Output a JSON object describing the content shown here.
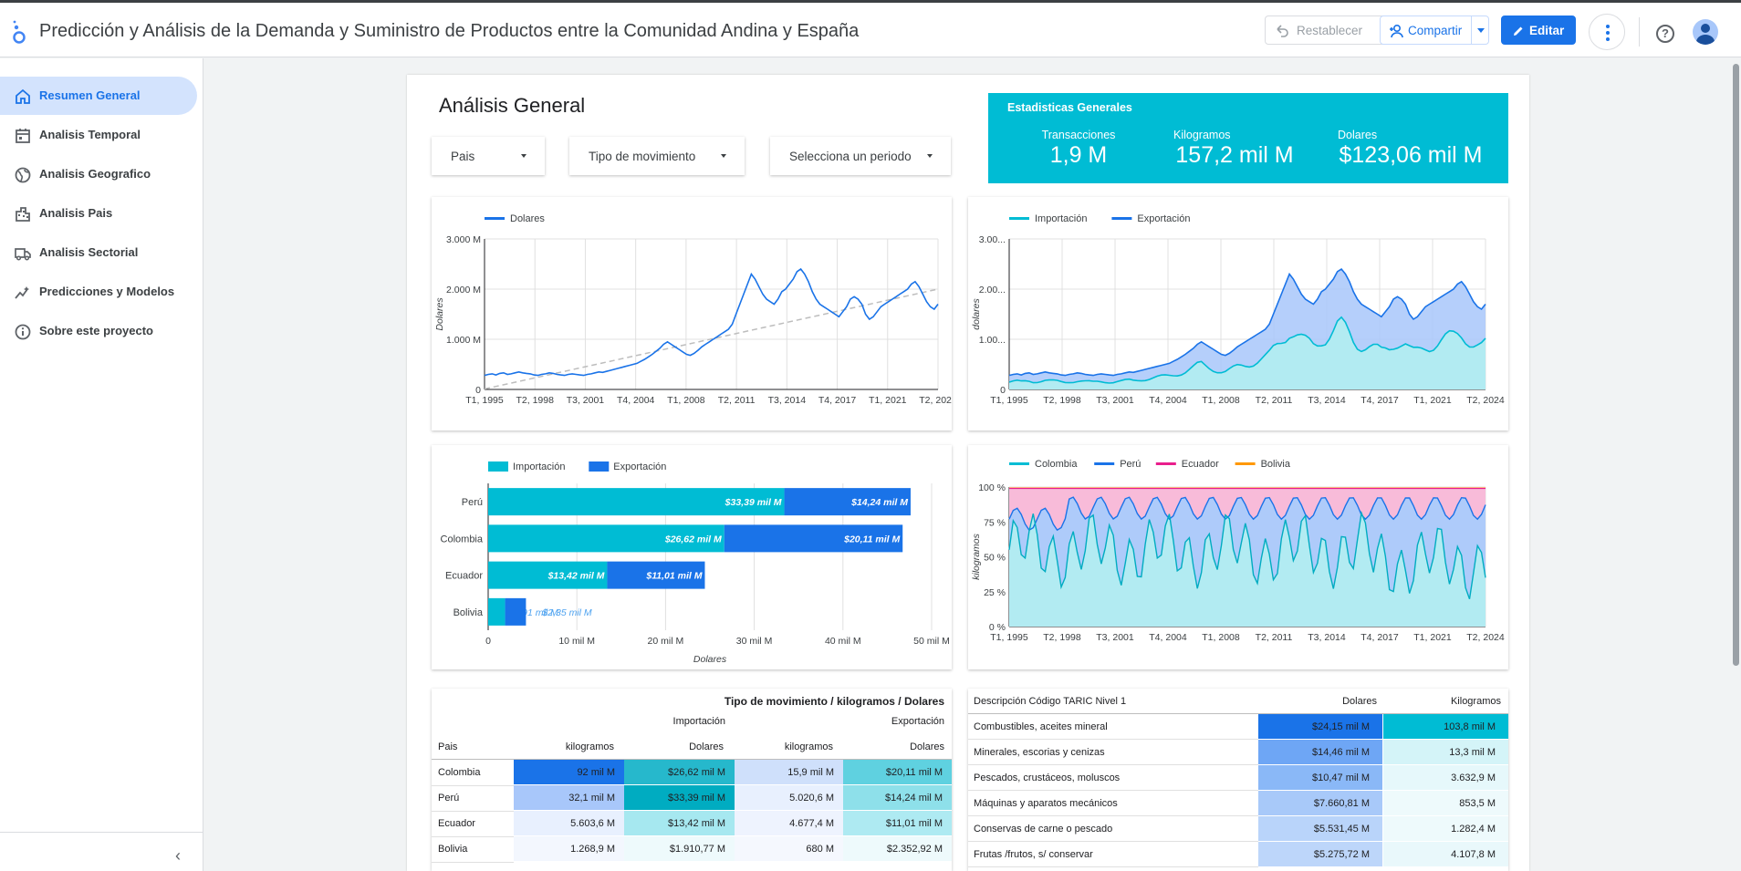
{
  "app": {
    "title": "Predicción y Análisis de la Demanda y Suministro de Productos entre la Comunidad Andina y España",
    "reset_label": "Restablecer",
    "share_label": "Compartir",
    "edit_label": "Editar",
    "help_glyph": "?",
    "collapse_glyph": "‹"
  },
  "nav": {
    "items": [
      {
        "label": "Resumen General",
        "icon": "home-icon"
      },
      {
        "label": "Analisis Temporal",
        "icon": "calendar-icon"
      },
      {
        "label": "Analisis Geografico",
        "icon": "globe-icon"
      },
      {
        "label": "Analisis Pais",
        "icon": "city-icon"
      },
      {
        "label": "Analisis Sectorial",
        "icon": "truck-icon"
      },
      {
        "label": "Predicciones y Modelos",
        "icon": "trend-icon"
      },
      {
        "label": "Sobre este proyecto",
        "icon": "info-icon"
      }
    ]
  },
  "page": {
    "title": "Análisis General",
    "filters": [
      "Pais",
      "Tipo de movimiento",
      "Selecciona un periodo"
    ]
  },
  "stats": {
    "title": "Estadisticas Generales",
    "items": [
      {
        "label": "Transacciones",
        "value": "1,9 M"
      },
      {
        "label": "Kilogramos",
        "value": "157,2 mil M"
      },
      {
        "label": "Dolares",
        "value": "$123,06 mil M"
      }
    ]
  },
  "colors": {
    "accent": "#1a73e8",
    "teal": "#00bcd4",
    "blue": "#1a73e8",
    "pink": "#e91e8c",
    "orange": "#ff9800"
  },
  "chart_data": [
    {
      "type": "line",
      "legend": [
        "Dolares"
      ],
      "ylabel": "Dolares",
      "yticks": [
        "0",
        "1.000 M",
        "2.000 M",
        "3.000 M"
      ],
      "ylim": [
        0,
        3000
      ],
      "xticks": [
        "T1, 1995",
        "T2, 1998",
        "T3, 2001",
        "T4, 2004",
        "T1, 2008",
        "T2, 2011",
        "T3, 2014",
        "T4, 2017",
        "T1, 2021",
        "T2, 2024"
      ],
      "trendline": true,
      "series": [
        {
          "name": "Dolares",
          "values": [
            280,
            300,
            310,
            290,
            320,
            330,
            300,
            310,
            330,
            350,
            330,
            320,
            310,
            290,
            280,
            300,
            310,
            330,
            320,
            300,
            290,
            280,
            300,
            310,
            300,
            290,
            280,
            300,
            310,
            330,
            350,
            340,
            360,
            380,
            400,
            420,
            440,
            460,
            480,
            500,
            520,
            560,
            600,
            650,
            700,
            760,
            820,
            900,
            950,
            900,
            850,
            800,
            750,
            700,
            680,
            720,
            780,
            850,
            900,
            950,
            1000,
            1050,
            1100,
            1150,
            1200,
            1300,
            1500,
            1700,
            1900,
            2100,
            2300,
            2200,
            2050,
            1900,
            1800,
            1750,
            1700,
            1800,
            1950,
            2000,
            2100,
            2200,
            2350,
            2400,
            2300,
            2150,
            1950,
            1800,
            1700,
            1650,
            1600,
            1550,
            1500,
            1450,
            1550,
            1650,
            1800,
            1850,
            1800,
            1700,
            1500,
            1400,
            1450,
            1550,
            1650,
            1700,
            1750,
            1800,
            1850,
            1900,
            1950,
            2000,
            2100,
            2150,
            2050,
            1900,
            1750,
            1650,
            1600,
            1700
          ]
        }
      ],
      "grid": true
    },
    {
      "type": "area",
      "stacked": true,
      "legend": [
        "Importación",
        "Exportación"
      ],
      "ylabel": "dolares",
      "yticks": [
        "0",
        "1.00...",
        "2.00...",
        "3.00..."
      ],
      "ylim": [
        0,
        3000
      ],
      "xticks": [
        "T1, 1995",
        "T2, 1998",
        "T3, 2001",
        "T4, 2004",
        "T1, 2008",
        "T2, 2011",
        "T3, 2014",
        "T4, 2017",
        "T1, 2021",
        "T2, 2024"
      ],
      "grid": true
    },
    {
      "type": "bar",
      "orientation": "horizontal",
      "stacked": true,
      "legend": [
        "Importación",
        "Exportación"
      ],
      "categories": [
        "Perú",
        "Colombia",
        "Ecuador",
        "Bolivia"
      ],
      "series": [
        {
          "name": "Importación",
          "values": [
            33.39,
            26.62,
            13.42,
            1.91
          ],
          "labels": [
            "$33,39 mil M",
            "$26,62 mil M",
            "$13,42 mil M",
            "$1,91 mil M"
          ]
        },
        {
          "name": "Exportación",
          "values": [
            14.24,
            20.11,
            11.01,
            2.35
          ],
          "labels": [
            "$14,24 mil M",
            "$20,11 mil M",
            "$11,01 mil M",
            "$2,35 mil M"
          ]
        }
      ],
      "xticks": [
        "0",
        "10 mil M",
        "20 mil M",
        "30 mil M",
        "40 mil M",
        "50 mil M"
      ],
      "xlim": [
        0,
        50
      ],
      "xlabel": "Dolares"
    },
    {
      "type": "area",
      "stacked": true,
      "percent": true,
      "legend": [
        "Colombia",
        "Perú",
        "Ecuador",
        "Bolivia"
      ],
      "ylabel": "kilogramos",
      "yticks": [
        "0 %",
        "25 %",
        "50 %",
        "75 %",
        "100 %"
      ],
      "ylim": [
        0,
        100
      ],
      "xticks": [
        "T1, 1995",
        "T2, 1998",
        "T3, 2001",
        "T4, 2004",
        "T1, 2008",
        "T2, 2011",
        "T3, 2014",
        "T4, 2017",
        "T1, 2021",
        "T2, 2024"
      ],
      "grid": true
    }
  ],
  "pivot_table": {
    "title": "Tipo de movimiento / kilogramos / Dolares",
    "groups": [
      "Importación",
      "Exportación"
    ],
    "row_header": "Pais",
    "columns": [
      "kilogramos",
      "Dolares",
      "kilogramos",
      "Dolares"
    ],
    "rows": [
      {
        "pais": "Colombia",
        "cells": [
          "92 mil M",
          "$26,62 mil M",
          "15,9 mil M",
          "$20,11 mil M"
        ]
      },
      {
        "pais": "Perú",
        "cells": [
          "32,1 mil M",
          "$33,39 mil M",
          "5.020,6 M",
          "$14,24 mil M"
        ]
      },
      {
        "pais": "Ecuador",
        "cells": [
          "5.603,6 M",
          "$13,42 mil M",
          "4.677,4 M",
          "$11,01 mil M"
        ]
      },
      {
        "pais": "Bolivia",
        "cells": [
          "1.268,9 M",
          "$1.910,77 M",
          "680 M",
          "$2.352,92 M"
        ]
      }
    ]
  },
  "taric_table": {
    "columns": [
      "Descripción Código TARIC Nivel 1",
      "Dolares",
      "Kilogramos"
    ],
    "rows": [
      {
        "desc": "Combustibles, aceites mineral",
        "dolares": "$24,15 mil M",
        "kg": "103,8 mil M"
      },
      {
        "desc": "Minerales, escorias y cenizas",
        "dolares": "$14,46 mil M",
        "kg": "13,3 mil M"
      },
      {
        "desc": "Pescados, crustáceos, moluscos",
        "dolares": "$10,47 mil M",
        "kg": "3.632,9 M"
      },
      {
        "desc": "Máquinas y aparatos mecánicos",
        "dolares": "$7.660,81 M",
        "kg": "853,5 M"
      },
      {
        "desc": "Conservas de carne o pescado",
        "dolares": "$5.531,45 M",
        "kg": "1.282,4 M"
      },
      {
        "desc": "Frutas /frutos, s/ conservar",
        "dolares": "$5.275,72 M",
        "kg": "4.107,8 M"
      }
    ]
  }
}
